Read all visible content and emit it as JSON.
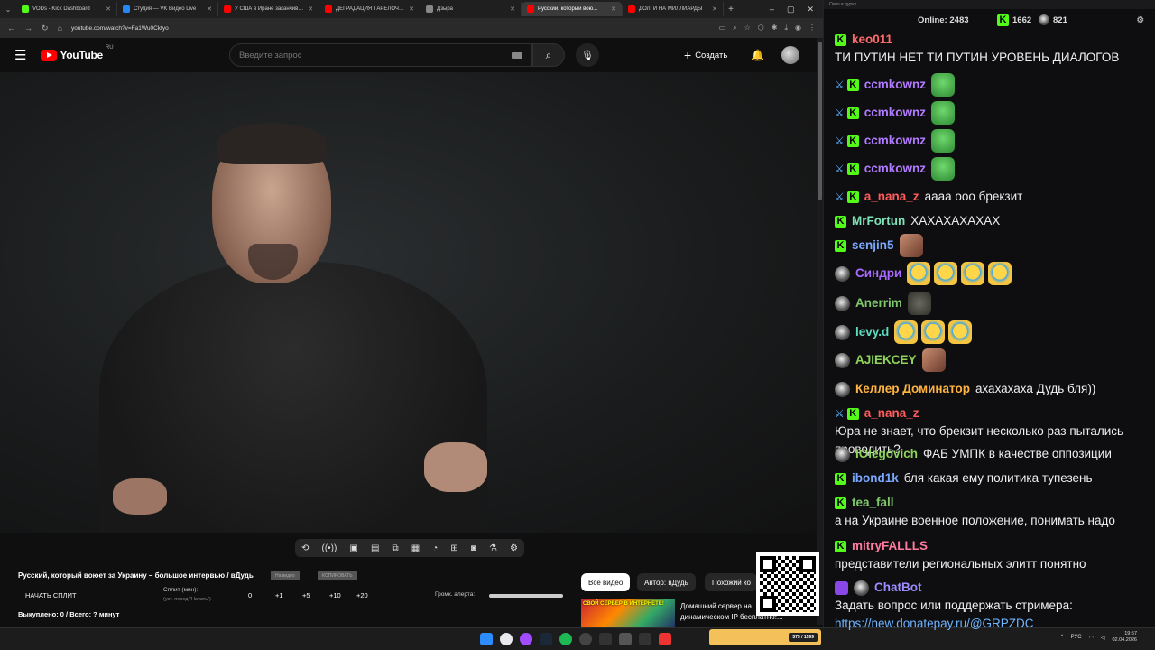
{
  "browser": {
    "tabs": [
      {
        "title": "VODs - Kick Dashboard",
        "color": "#53fc18"
      },
      {
        "title": "Студия — VK Видео Live",
        "color": "#2787f5"
      },
      {
        "title": "У США в Иране заканчива...",
        "color": "#ff0000"
      },
      {
        "title": "ДЕГРАДАЦИЯ ТАРЕЛОЧНИ...",
        "color": "#ff0000"
      },
      {
        "title": "Дзыра",
        "color": "#888888"
      },
      {
        "title": "Русский, который вою...",
        "color": "#ff0000",
        "active": true
      },
      {
        "title": "ДОЛГИ НА МИЛЛИАРДЫ",
        "color": "#ff0000"
      }
    ],
    "url": "youtube.com/watch?v=Fa1Wu0Cktyo"
  },
  "youtube": {
    "region": "RU",
    "logo_text": "YouTube",
    "search_placeholder": "Введите запрос",
    "create_label": "Создать"
  },
  "video": {
    "title": "Русский, который воюет за Украину – большое интервью / вДудь",
    "pill1": "На видео",
    "pill2": "КОПИРОВАТЬ"
  },
  "split": {
    "start_label": "НАЧАТЬ СПЛИТ",
    "label": "Сплит (мин):",
    "sub": "(уст. перед \"Начать\")",
    "values": [
      "0",
      "+1",
      "+5",
      "+10",
      "+20"
    ],
    "alert_label": "Громк. алерта:",
    "alert_level": 1.0,
    "bought": "Выкуплено: 0 / Всего: ? минут"
  },
  "chips": [
    "Все видео",
    "Автор: вДудь",
    "Похожий ко"
  ],
  "recommendation": {
    "thumb_text": "СВОЙ СЕРВЕР В ИНТЕРНЕТЕ!",
    "title": "Домашний сервер на динамическом IP бесплатно!..."
  },
  "taskbar": {
    "badge_text": "575 / 1599",
    "lang": "РУС",
    "time": "19:57",
    "date": "02.04.2026"
  },
  "chat": {
    "window_title": "Окно в дурку",
    "online_label": "Online:",
    "online_count": "2483",
    "kick_count": "1662",
    "other_count": "821",
    "messages": [
      {
        "name": "keo011",
        "color": "#ff6b6b",
        "text": "ТИ ПУТИН НЕТ ТИ ПУТИН УРОВЕНЬ ДИАЛОГОВ",
        "badges": [
          "kick"
        ]
      },
      {
        "name": "ccmkownz",
        "color": "#b27cff",
        "text": "",
        "badges": [
          "sword",
          "kick"
        ],
        "emotes": [
          "pepe"
        ]
      },
      {
        "name": "ccmkownz",
        "color": "#b27cff",
        "text": "",
        "badges": [
          "sword",
          "kick"
        ],
        "emotes": [
          "pepe"
        ]
      },
      {
        "name": "ccmkownz",
        "color": "#b27cff",
        "text": "",
        "badges": [
          "sword",
          "kick"
        ],
        "emotes": [
          "pepe"
        ]
      },
      {
        "name": "ccmkownz",
        "color": "#b27cff",
        "text": "",
        "badges": [
          "sword",
          "kick"
        ],
        "emotes": [
          "pepe"
        ]
      },
      {
        "name": "a_nana_z",
        "color": "#ff5c5c",
        "text": "аааа ооо брекзит",
        "badges": [
          "sword",
          "kick"
        ]
      },
      {
        "name": "MrFortun",
        "color": "#7ee2b8",
        "text": "ХАХАХАХАХАХ",
        "badges": [
          "kick"
        ]
      },
      {
        "name": "senjin5",
        "color": "#7aa8ff",
        "text": "",
        "badges": [
          "kick"
        ],
        "emotes": [
          "photo"
        ]
      },
      {
        "name": "Синдри",
        "color": "#a96bff",
        "text": "",
        "badges": [
          "avatar"
        ],
        "emotes": [
          "laugh",
          "laugh",
          "laugh",
          "laugh"
        ]
      },
      {
        "name": "Anerrim",
        "color": "#7ec86a",
        "text": "",
        "badges": [
          "avatar"
        ],
        "emotes": [
          "cat"
        ]
      },
      {
        "name": "levy.d",
        "color": "#5ddcc0",
        "text": "",
        "badges": [
          "avatar"
        ],
        "emotes": [
          "laugh",
          "laugh",
          "laugh"
        ]
      },
      {
        "name": "AJIEKCEY",
        "color": "#8fd45a",
        "text": "",
        "badges": [
          "avatar"
        ],
        "emotes": [
          "photo"
        ]
      },
      {
        "name": "Келлер Доминатор",
        "color": "#ffb340",
        "text": "ахахахаха Дудь бля))",
        "badges": [
          "avatar"
        ]
      },
      {
        "name": "a_nana_z",
        "color": "#ff5c5c",
        "text": "Юра не знает, что брекзит несколько раз пытались проводить?",
        "badges": [
          "sword",
          "kick"
        ]
      },
      {
        "name": "IOlegovich",
        "color": "#8fd45a",
        "text": "ФАБ УМПК в качестве оппозиции",
        "badges": [
          "avatar"
        ]
      },
      {
        "name": "ibond1k",
        "color": "#7aa8ff",
        "text": "бля какая ему политика тупезень",
        "badges": [
          "kick"
        ]
      },
      {
        "name": "tea_fall",
        "color": "#7ec86a",
        "text": "а на Украине военное положение, понимать надо",
        "badges": [
          "kick"
        ]
      },
      {
        "name": "mitryFALLLS",
        "color": "#ff7aa0",
        "text": "представители региональных элитт понятно",
        "badges": [
          "kick"
        ]
      },
      {
        "name": "ChatBot",
        "color": "#9b8cff",
        "text": "Задать вопрос или поддержать стримера:",
        "link": "https://new.donatepay.ru/@GRPZDC",
        "badges": [
          "bot",
          "avatar"
        ]
      }
    ]
  }
}
